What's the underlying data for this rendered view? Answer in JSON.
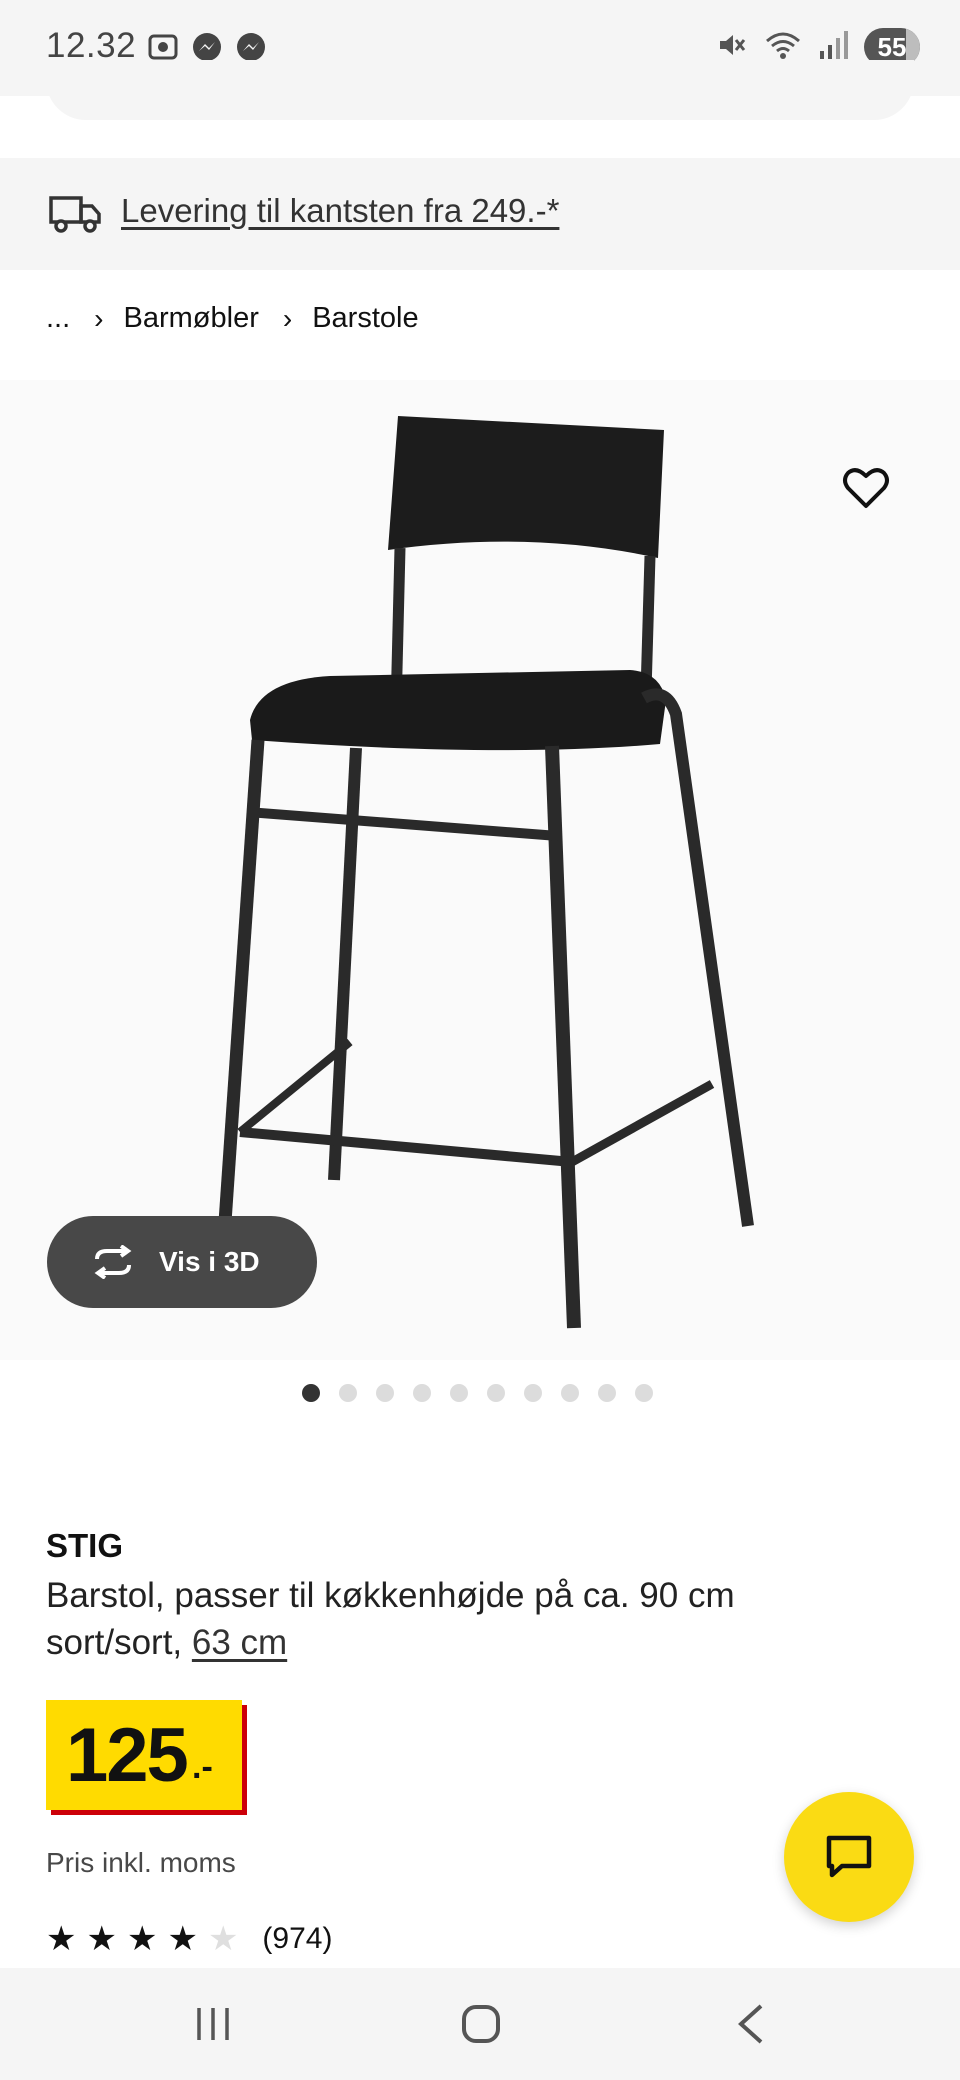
{
  "status_bar": {
    "time": "12.32",
    "left_icons": [
      "screenshot-icon",
      "messenger-icon",
      "messenger-icon"
    ],
    "right_icons": [
      "mute-icon",
      "wifi-icon",
      "signal-icon"
    ],
    "battery": "55"
  },
  "delivery": {
    "icon": "truck-icon",
    "text": "Levering til kantsten fra 249.-*"
  },
  "breadcrumb": {
    "items": [
      "...",
      "Barmøbler",
      "Barstole"
    ]
  },
  "product_image": {
    "alt_subject": "black bar stool",
    "view_3d_label": "Vis i 3D",
    "image_count": 10,
    "active_index": 0
  },
  "product": {
    "name": "STIG",
    "description_line1": "Barstol, passer til køkkenhøjde på ca. 90 cm",
    "variant_prefix": "sort/sort, ",
    "size_link": "63 cm",
    "price_whole": "125",
    "price_suffix": ".-",
    "price_note": "Pris inkl. moms",
    "rating_value": 4,
    "rating_max": 5,
    "rating_count": "(974)"
  },
  "colors": {
    "price_yellow": "#ffdb00",
    "price_shadow_red": "#cc0008",
    "chat_yellow": "#fadb14",
    "view3d_bg": "#484848"
  },
  "nav": {
    "recent": "recent-apps-icon",
    "home": "home-icon",
    "back": "back-icon"
  }
}
